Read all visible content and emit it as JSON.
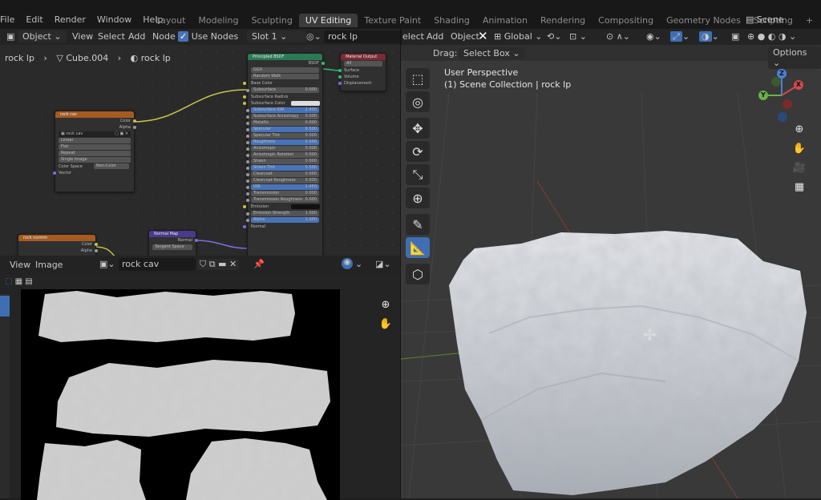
{
  "menus": [
    "File",
    "Edit",
    "Render",
    "Window",
    "Help"
  ],
  "workspaces": [
    "Layout",
    "Modeling",
    "Sculpting",
    "UV Editing",
    "Texture Paint",
    "Shading",
    "Animation",
    "Rendering",
    "Compositing",
    "Geometry Nodes",
    "Scripting"
  ],
  "active_workspace": "UV Editing",
  "scene_label": "Scene",
  "node_header": {
    "mode": "Object",
    "menus": [
      "View",
      "Select",
      "Add",
      "Node"
    ],
    "use_nodes_label": "Use Nodes",
    "slot": "Slot 1",
    "material": "rock lp"
  },
  "breadcrumb": {
    "object": "rock lp",
    "mesh": "Cube.004",
    "material": "rock lp"
  },
  "nodes": {
    "tex_cav": {
      "title": "rock cav",
      "outputs": [
        "Color",
        "Alpha"
      ],
      "image": "rock cav",
      "opts": [
        "Linear",
        "Flat",
        "Repeat",
        "Single Image"
      ],
      "colorspace_label": "Color Space",
      "colorspace": "Non-Color",
      "input": "Vector"
    },
    "tex_normal": {
      "title": "rock normm",
      "outputs": [
        "Color",
        "Alpha"
      ]
    },
    "normal_map": {
      "title": "Normal Map",
      "output": "Normal",
      "space": "Tangent Space"
    },
    "bsdf": {
      "title": "Principled BSDF",
      "output": "BSDF",
      "distribution": "GGX",
      "subsurface_method": "Random Walk",
      "rows": [
        {
          "label": "Base Color",
          "value": ""
        },
        {
          "label": "Subsurface",
          "value": "0.000"
        },
        {
          "label": "Subsurface Radius",
          "value": ""
        },
        {
          "label": "Subsurface Color",
          "value": ""
        },
        {
          "label": "Subsurface IOR",
          "value": "1.400"
        },
        {
          "label": "Subsurface Anisotropy",
          "value": "0.000"
        },
        {
          "label": "Metallic",
          "value": "0.000"
        },
        {
          "label": "Specular",
          "value": "0.500"
        },
        {
          "label": "Specular Tint",
          "value": "0.000"
        },
        {
          "label": "Roughness",
          "value": "0.500"
        },
        {
          "label": "Anisotropic",
          "value": "0.000"
        },
        {
          "label": "Anisotropic Rotation",
          "value": "0.000"
        },
        {
          "label": "Sheen",
          "value": "0.000"
        },
        {
          "label": "Sheen Tint",
          "value": "0.500"
        },
        {
          "label": "Clearcoat",
          "value": "0.000"
        },
        {
          "label": "Clearcoat Roughness",
          "value": "0.030"
        },
        {
          "label": "IOR",
          "value": "1.450"
        },
        {
          "label": "Transmission",
          "value": "0.000"
        },
        {
          "label": "Transmission Roughness",
          "value": "0.000"
        },
        {
          "label": "Emission",
          "value": ""
        },
        {
          "label": "Emission Strength",
          "value": "1.000"
        },
        {
          "label": "Alpha",
          "value": "1.000"
        },
        {
          "label": "Normal",
          "value": ""
        }
      ]
    },
    "output": {
      "title": "Material Output",
      "target": "All",
      "inputs": [
        "Surface",
        "Volume",
        "Displacement"
      ]
    }
  },
  "image_editor": {
    "menus": [
      "View",
      "Image"
    ],
    "image_name": "rock cav"
  },
  "viewport": {
    "drag_label": "Drag:",
    "drag_mode": "Select Box",
    "orientation": "Global",
    "options_label": "Options",
    "menus": [
      "elect",
      "Add",
      "Object"
    ],
    "perspective": "User Perspective",
    "collection": "(1) Scene Collection | rock lp",
    "axes": {
      "x": "X",
      "y": "Y",
      "z": "Z"
    }
  },
  "colors": {
    "accent": "#4873b8",
    "node_texture": "#a55a22",
    "node_vector": "#4a3a8c",
    "node_shader": "#2a7a56",
    "node_output": "#7a2a34"
  }
}
